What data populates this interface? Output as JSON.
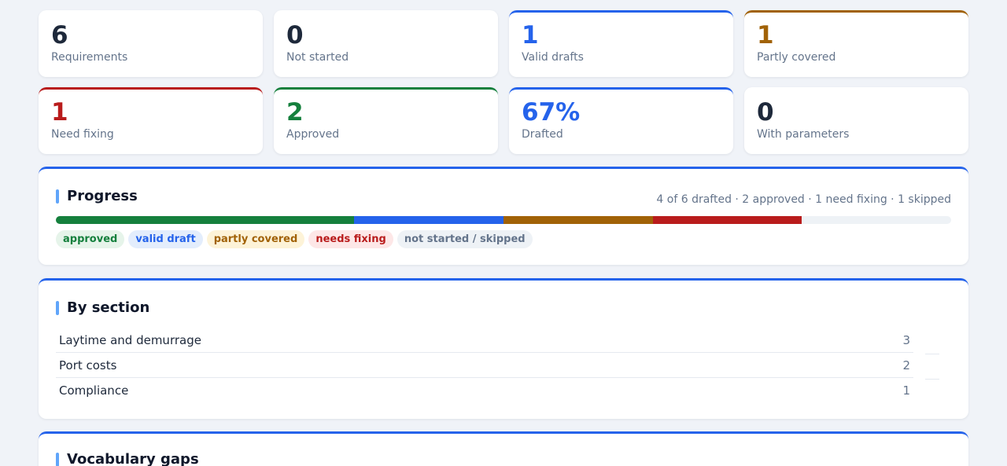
{
  "stats": [
    {
      "value": "6",
      "label": "Requirements"
    },
    {
      "value": "0",
      "label": "Not started"
    },
    {
      "value": "1",
      "label": "Valid drafts"
    },
    {
      "value": "1",
      "label": "Partly covered"
    },
    {
      "value": "1",
      "label": "Need fixing"
    },
    {
      "value": "2",
      "label": "Approved"
    },
    {
      "value": "67%",
      "label": "Drafted"
    },
    {
      "value": "0",
      "label": "With parameters"
    }
  ],
  "progress": {
    "title": "Progress",
    "summary": "4 of 6 drafted · 2 approved · 1 need fixing · 1 skipped",
    "segments": [
      {
        "status": "approved",
        "count": 2,
        "color": "#15803d"
      },
      {
        "status": "valid draft",
        "count": 1,
        "color": "#2563eb"
      },
      {
        "status": "partly covered",
        "count": 1,
        "color": "#a16207"
      },
      {
        "status": "needs fixing",
        "count": 1,
        "color": "#b91c1c"
      }
    ],
    "total": 6,
    "legend": [
      {
        "label": "approved",
        "color": "#15803d",
        "bg": "#e6f4ea"
      },
      {
        "label": "valid draft",
        "color": "#2563eb",
        "bg": "#e3edfc"
      },
      {
        "label": "partly covered",
        "color": "#a16207",
        "bg": "#fdf3d8"
      },
      {
        "label": "needs fixing",
        "color": "#b91c1c",
        "bg": "#fde7e7"
      },
      {
        "label": "not started / skipped",
        "color": "#64748b",
        "bg": "#eef2f6"
      }
    ]
  },
  "by_section": {
    "title": "By section",
    "rows": [
      {
        "name": "Laytime and demurrage",
        "count": "3"
      },
      {
        "name": "Port costs",
        "count": "2"
      },
      {
        "name": "Compliance",
        "count": "1"
      }
    ]
  },
  "vocabulary": {
    "title": "Vocabulary gaps"
  }
}
